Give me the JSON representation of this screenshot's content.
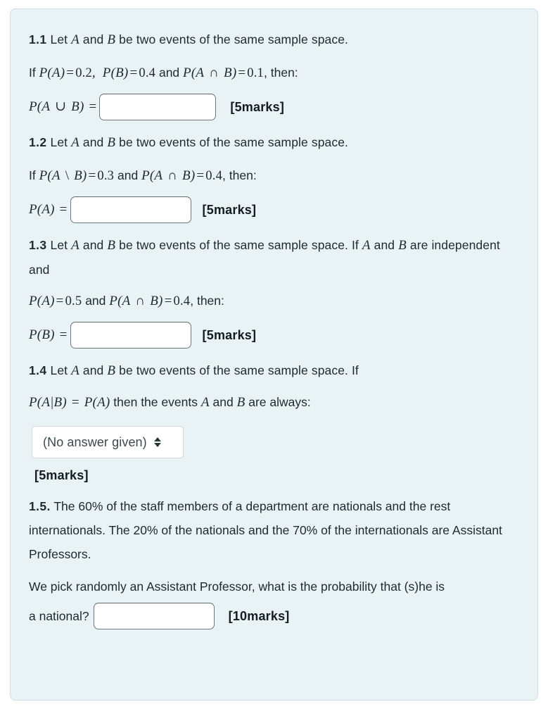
{
  "card": {
    "background_color": "#e9f2f4",
    "border_color": "#cfdfe2"
  },
  "questions": [
    {
      "number": "1.1",
      "stem": "Let $A$ and $B$ be two events of the same sample space.",
      "given_prefix": "If ",
      "given_math": "P(A) = 0.2, P(B) = 0.4 and P(A ∩ B) = 0.1, then:",
      "answer_label": "P(A ∪ B) =",
      "input_value": "",
      "marks": "[5marks]"
    },
    {
      "number": "1.2",
      "stem": "Let $A$ and $B$ be two events of the same sample space.",
      "given_prefix": "If ",
      "given_math": "P(A \\ B) = 0.3 and P(A ∩ B) = 0.4, then:",
      "answer_label": "P(A) =",
      "input_value": "",
      "marks": "[5marks]"
    },
    {
      "number": "1.3",
      "stem_line1": "Let $A$ and $B$ be two events of the same sample space. If $A$ and $B$ are",
      "stem_line2": "independent and",
      "given_math": "P(A) = 0.5 and P(A ∩ B) = 0.4, then:",
      "answer_label": "P(B) =",
      "input_value": "",
      "marks": "[5marks]"
    },
    {
      "number": "1.4",
      "stem_line1": "Let $A$ and $B$ be two events of the same sample space. If",
      "stem_line2_math": "P(A|B) = P(A) then the events A and B are always:",
      "select_value": "(No answer given)",
      "marks": "[5marks]"
    },
    {
      "number": "1.5.",
      "body_line1": " The 60% of the staff members of a department are nationals and the",
      "body_line2": "rest internationals. The 20% of the nationals and the 70% of the",
      "body_line3": "internationals are Assistant Professors.",
      "body_line4": "We pick randomly an Assistant Professor, what is the probability that (s)he is",
      "answer_label": "a national?",
      "input_value": "",
      "marks": "[10marks]"
    }
  ],
  "labels": {
    "let_text": "Let",
    "and_text": "and",
    "be_two_events": "be two events of the same sample space.",
    "if_text": "If",
    "then_text": "then:",
    "independent_and": "independent and",
    "are_text": "are",
    "if_short": "If",
    "then_events": "then the events",
    "are_always": "are always:"
  }
}
